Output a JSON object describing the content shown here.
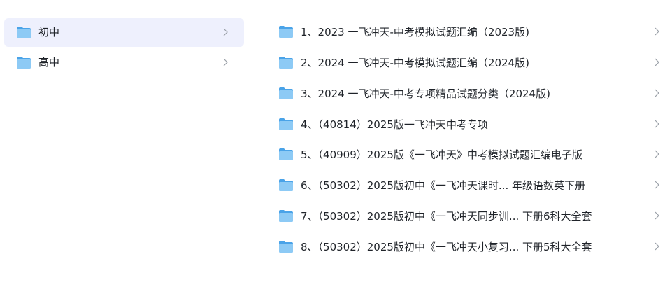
{
  "categories": [
    {
      "label": "初中",
      "active": true
    },
    {
      "label": "高中",
      "active": false
    }
  ],
  "files": [
    {
      "label": "1、2023 一飞冲天-中考模拟试题汇编（2023版)"
    },
    {
      "label": "2、2024 一飞冲天-中考模拟试题汇编（2024版)"
    },
    {
      "label": "3、2024 一飞冲天-中考专项精品试题分类（2024版)"
    },
    {
      "label": "4、（40814）2025版一飞冲天中考专项"
    },
    {
      "label": "5、（40909）2025版《一飞冲天》中考模拟试题汇编电子版"
    },
    {
      "label": "6、（50302）2025版初中《一飞冲天课时... 年级语数英下册"
    },
    {
      "label": "7、（50302）2025版初中《一飞冲天同步训... 下册6科大全套"
    },
    {
      "label": "8、（50302）2025版初中《一飞冲天小复习... 下册5科大全套"
    }
  ],
  "icons": {
    "folder": "folder-icon",
    "chevron": "chevron-right-icon"
  },
  "colors": {
    "folder_back": "#4aa3e8",
    "folder_front": "#8dcaf5",
    "active_bg": "#eef0fd",
    "chevron": "#9aa0a8",
    "divider": "#e6e8eb"
  }
}
